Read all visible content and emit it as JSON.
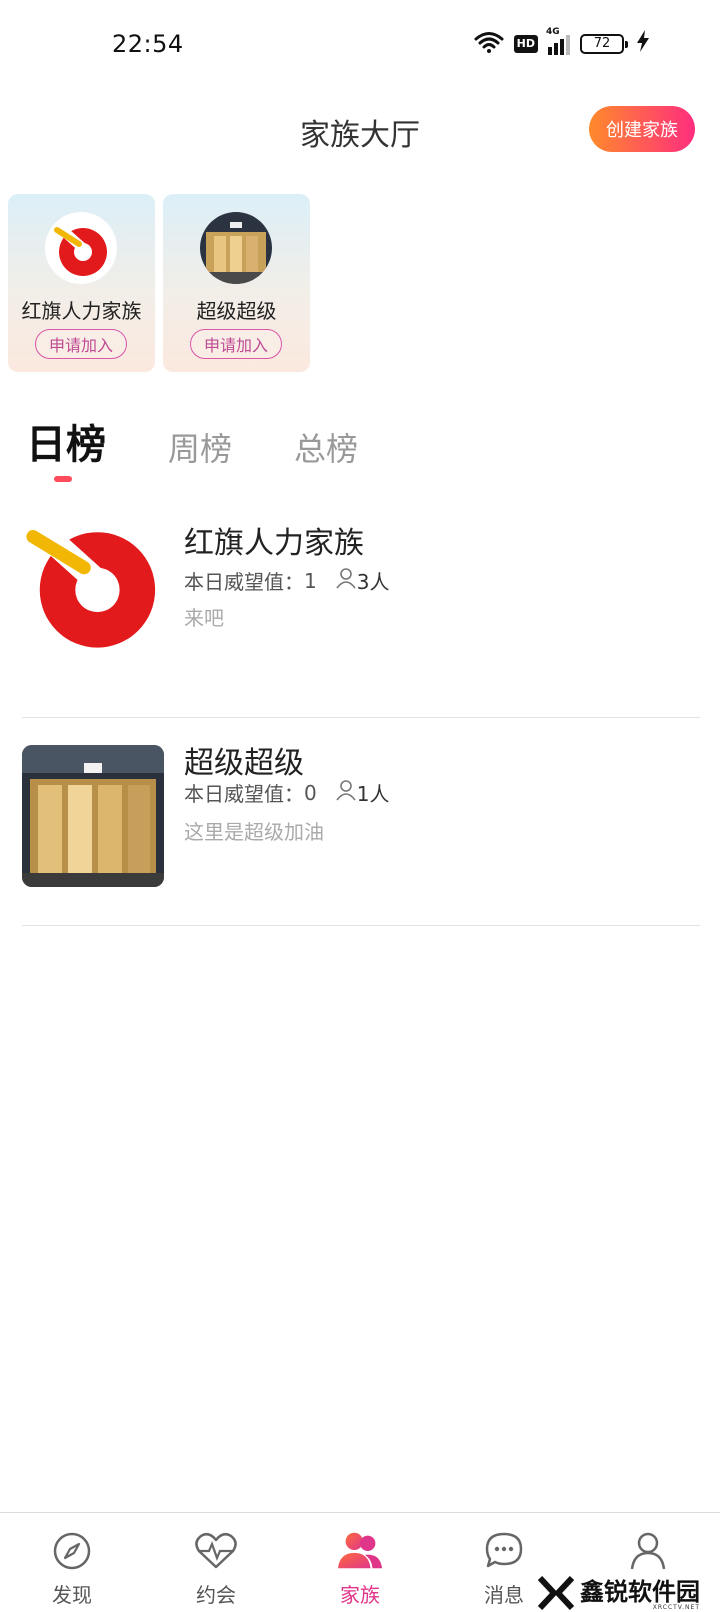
{
  "status_bar": {
    "time": "22:54",
    "network": "4G",
    "hd": "HD",
    "battery": "72"
  },
  "header": {
    "title": "家族大厅",
    "create_button": "创建家族"
  },
  "family_cards": [
    {
      "name": "红旗人力家族",
      "join_label": "申请加入"
    },
    {
      "name": "超级超级",
      "join_label": "申请加入"
    }
  ],
  "tabs": [
    {
      "label": "日榜",
      "active": true
    },
    {
      "label": "周榜",
      "active": false
    },
    {
      "label": "总榜",
      "active": false
    }
  ],
  "ranking": [
    {
      "name": "红旗人力家族",
      "prestige_label": "本日威望值：",
      "prestige_value": "1",
      "members": "3人",
      "description": "来吧"
    },
    {
      "name": "超级超级",
      "prestige_label": "本日威望值：",
      "prestige_value": "0",
      "members": "1人",
      "description": "这里是超级加油"
    }
  ],
  "bottom_nav": [
    {
      "label": "发现",
      "icon": "compass-icon",
      "active": false
    },
    {
      "label": "约会",
      "icon": "heartbeat-icon",
      "active": false
    },
    {
      "label": "家族",
      "icon": "group-icon",
      "active": true
    },
    {
      "label": "消息",
      "icon": "chat-bubble-icon",
      "active": false
    },
    {
      "label": "",
      "icon": "user-icon",
      "active": false
    }
  ],
  "watermark": {
    "text": "鑫锐软件园",
    "sub": "XRCCTV.NET"
  },
  "colors": {
    "accent": "#e0368a",
    "create_gradient_start": "#ff8a2b",
    "create_gradient_end": "#ff2d7f",
    "tab_underline": "#ff4b5c"
  }
}
